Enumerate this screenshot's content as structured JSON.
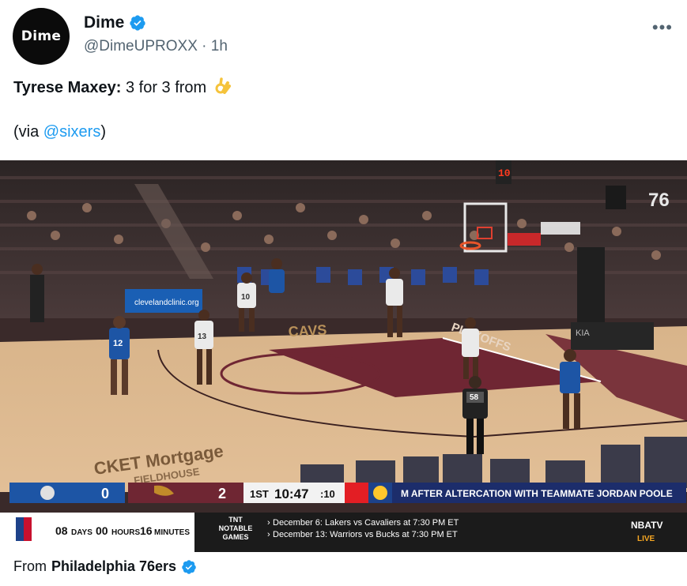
{
  "author": {
    "avatar_text": "Dime",
    "name": "Dime",
    "handle": "@DimeUPROXX",
    "time": "1h",
    "verified": true
  },
  "tweet": {
    "player": "Tyrese Maxey:",
    "text": "3 for 3 from",
    "emoji": "ok-hand-emoji",
    "via_prefix": "(via ",
    "via_mention": "@sixers",
    "via_suffix": ")"
  },
  "video": {
    "scoreboard": {
      "team1_score": "0",
      "team2_score": "2",
      "quarter": "1ST",
      "clock": "10:47",
      "shot_clock": ":10",
      "ticker": "M AFTER ALTERCATION WITH TEAMMATE JORDAN POOLE"
    },
    "tipoff": {
      "days": "08",
      "days_label": "DAYS",
      "hours": "00",
      "hours_label": "HOURS",
      "minutes": "16",
      "minutes_label": "MINUTES"
    },
    "tnt": {
      "label_line1": "TNT",
      "label_line2": "NOTABLE",
      "label_line3": "GAMES",
      "games": [
        "December 6: Lakers vs Cavaliers at 7:30 PM ET",
        "December 13: Warriors vs Bucks at 7:30 PM ET"
      ]
    },
    "nbatv": {
      "brand": "NBATV",
      "live": "LIVE"
    },
    "court": {
      "floor_text_caves": "CAVS",
      "floor_text_playoffs": "PLAYOFFS",
      "sponsor_text_1": "CKET Mortgage",
      "sponsor_text_2": "FIELDHOUSE",
      "board_text": "clevelandclinic.org",
      "corner_logo": "76",
      "shot_clock_text": "10",
      "jerseys": [
        "12",
        "10",
        "13",
        "58"
      ]
    }
  },
  "footer": {
    "prefix": "From",
    "source": "Philadelphia 76ers",
    "verified": true
  },
  "colors": {
    "verified_blue": "#1d9bf0",
    "link_blue": "#1d9bf0",
    "sixers_blue": "#1d55a5",
    "cavs_wine": "#6f2633",
    "ticker_navy": "#1c2d6b"
  }
}
